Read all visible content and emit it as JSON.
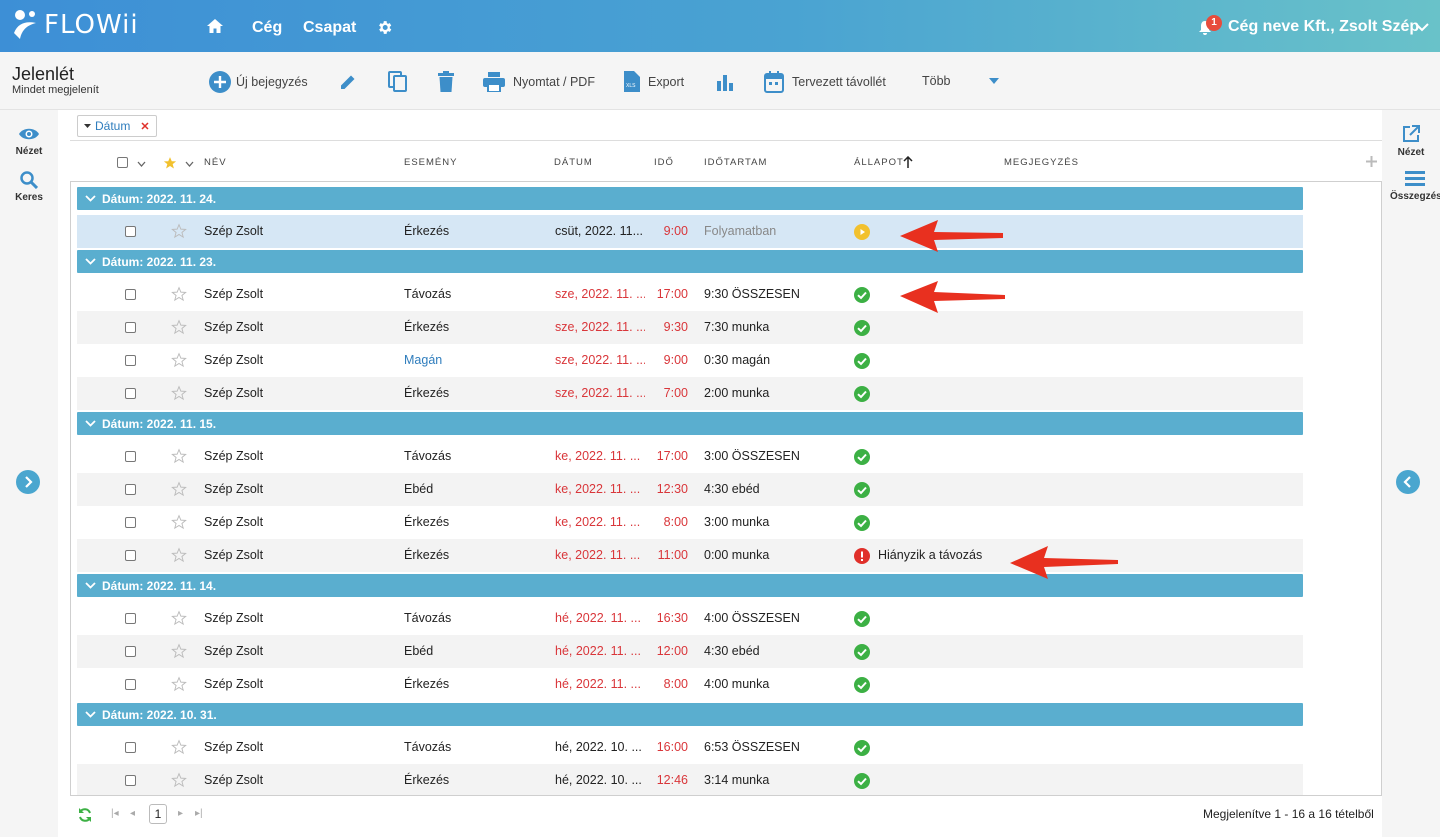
{
  "app": {
    "logo": "FLOWii",
    "nav": [
      "Cég",
      "Csapat"
    ],
    "notification_count": "1",
    "company": "Cég neve Kft., Zsolt Szép"
  },
  "page": {
    "title": "Jelenlét",
    "subtitle": "Mindet megjelenít"
  },
  "toolbar": {
    "new": "Új bejegyzés",
    "print": "Nyomtat / PDF",
    "export": "Export",
    "planned": "Tervezett távollét",
    "more": "Több"
  },
  "sidebar_left": {
    "view": "Nézet",
    "search": "Keres"
  },
  "sidebar_right": {
    "view": "Nézet",
    "summary": "Összegzés"
  },
  "filter": {
    "chip": "Dátum"
  },
  "columns": {
    "name": "NÉV",
    "event": "ESEMÉNY",
    "date": "DÁTUM",
    "time": "IDŐ",
    "duration": "IDŐTARTAM",
    "status": "ÁLLAPOT",
    "note": "MEGJEGYZÉS"
  },
  "groups": [
    {
      "label": "Dátum: 2022. 11. 24.",
      "rows": [
        {
          "name": "Szép Zsolt",
          "event": "Érkezés",
          "date": "csüt, 2022. 11...",
          "time": "9:00",
          "duration": "Folyamatban",
          "status": "progress",
          "status_text": "",
          "date_color": "normal",
          "event_color": "normal"
        }
      ]
    },
    {
      "label": "Dátum: 2022. 11. 23.",
      "rows": [
        {
          "name": "Szép Zsolt",
          "event": "Távozás",
          "date": "sze, 2022. 11. ...",
          "time": "17:00",
          "duration": "9:30 ÖSSZESEN",
          "status": "ok",
          "status_text": "",
          "date_color": "red",
          "event_color": "normal"
        },
        {
          "name": "Szép Zsolt",
          "event": "Érkezés",
          "date": "sze, 2022. 11. ...",
          "time": "9:30",
          "duration": "7:30 munka",
          "status": "ok",
          "status_text": "",
          "date_color": "red",
          "event_color": "normal"
        },
        {
          "name": "Szép Zsolt",
          "event": "Magán",
          "date": "sze, 2022. 11. ...",
          "time": "9:00",
          "duration": "0:30 magán",
          "status": "ok",
          "status_text": "",
          "date_color": "red",
          "event_color": "blue"
        },
        {
          "name": "Szép Zsolt",
          "event": "Érkezés",
          "date": "sze, 2022. 11. ...",
          "time": "7:00",
          "duration": "2:00 munka",
          "status": "ok",
          "status_text": "",
          "date_color": "red",
          "event_color": "normal"
        }
      ]
    },
    {
      "label": "Dátum: 2022. 11. 15.",
      "rows": [
        {
          "name": "Szép Zsolt",
          "event": "Távozás",
          "date": "ke, 2022. 11. ...",
          "time": "17:00",
          "duration": "3:00 ÖSSZESEN",
          "status": "ok",
          "status_text": "",
          "date_color": "red",
          "event_color": "normal"
        },
        {
          "name": "Szép Zsolt",
          "event": "Ebéd",
          "date": "ke, 2022. 11. ...",
          "time": "12:30",
          "duration": "4:30 ebéd",
          "status": "ok",
          "status_text": "",
          "date_color": "red",
          "event_color": "normal"
        },
        {
          "name": "Szép Zsolt",
          "event": "Érkezés",
          "date": "ke, 2022. 11. ...",
          "time": "8:00",
          "duration": "3:00 munka",
          "status": "ok",
          "status_text": "",
          "date_color": "red",
          "event_color": "normal"
        },
        {
          "name": "Szép Zsolt",
          "event": "Érkezés",
          "date": "ke, 2022. 11. ...",
          "time": "11:00",
          "duration": "0:00 munka",
          "status": "error",
          "status_text": "Hiányzik a távozás",
          "date_color": "red",
          "event_color": "normal"
        }
      ]
    },
    {
      "label": "Dátum: 2022. 11. 14.",
      "rows": [
        {
          "name": "Szép Zsolt",
          "event": "Távozás",
          "date": "hé, 2022. 11. ...",
          "time": "16:30",
          "duration": "4:00 ÖSSZESEN",
          "status": "ok",
          "status_text": "",
          "date_color": "red",
          "event_color": "normal"
        },
        {
          "name": "Szép Zsolt",
          "event": "Ebéd",
          "date": "hé, 2022. 11. ...",
          "time": "12:00",
          "duration": "4:30 ebéd",
          "status": "ok",
          "status_text": "",
          "date_color": "red",
          "event_color": "normal"
        },
        {
          "name": "Szép Zsolt",
          "event": "Érkezés",
          "date": "hé, 2022. 11. ...",
          "time": "8:00",
          "duration": "4:00 munka",
          "status": "ok",
          "status_text": "",
          "date_color": "red",
          "event_color": "normal"
        }
      ]
    },
    {
      "label": "Dátum: 2022. 10. 31.",
      "rows": [
        {
          "name": "Szép Zsolt",
          "event": "Távozás",
          "date": "hé, 2022. 10. ...",
          "time": "16:00",
          "duration": "6:53 ÖSSZESEN",
          "status": "ok",
          "status_text": "",
          "date_color": "normal",
          "event_color": "normal"
        },
        {
          "name": "Szép Zsolt",
          "event": "Érkezés",
          "date": "hé, 2022. 10. ...",
          "time": "12:46",
          "duration": "3:14 munka",
          "status": "ok",
          "status_text": "",
          "date_color": "normal",
          "event_color": "normal"
        }
      ]
    }
  ],
  "pager": {
    "page": "1",
    "summary": "Megjelenítve 1 - 16 a 16 tételből"
  },
  "colors": {
    "accent": "#5aaecf",
    "ok": "#3cb044",
    "error": "#e0302a",
    "progress": "#f2c12e",
    "arrow": "#e8301f"
  }
}
